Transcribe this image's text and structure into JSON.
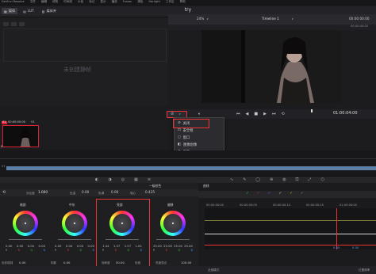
{
  "app": {
    "menu": [
      "DaVinci Resolve",
      "文件",
      "编辑",
      "修剪",
      "时间线",
      "片段",
      "标记",
      "显示",
      "播放",
      "Fusion",
      "调色",
      "Fairlight",
      "工作区",
      "帮助"
    ],
    "project_title": "try"
  },
  "toolbar": {
    "media_pool": "媒体",
    "lut": "LUT",
    "clip_library": "媒体夹",
    "zoom": "24%",
    "timeline_name": "Timeline 1",
    "timecode_top": "00:00:00:00"
  },
  "media_panel": {
    "watermark": "未创建静帧"
  },
  "viewer": {
    "overlay_menu_icon": "circle-slash-icon",
    "timecode": "01:00:04:00"
  },
  "dropdown": {
    "items": [
      {
        "label": "关闭",
        "icon": "off-icon"
      },
      {
        "label": "安全框",
        "icon": "safe-area-icon"
      },
      {
        "label": "窗口",
        "icon": "window-icon"
      },
      {
        "label": "图像划像",
        "icon": "wipe-icon"
      },
      {
        "label": "跟踪",
        "icon": "tracker-icon"
      },
      {
        "label": "Open FX 叠加",
        "icon": "fx-overlay-icon"
      },
      {
        "label": "蒸汽",
        "icon": "other-icon"
      }
    ]
  },
  "clip": {
    "index": "01",
    "timecode": "00:00:00:00",
    "track": "V1",
    "format": "JPEG"
  },
  "color": {
    "params": {
      "contrast_label": "对比度",
      "contrast": "1.000",
      "pivot_label": "轴心",
      "pivot": "0.435",
      "temp_label": "色温",
      "temp": "0.00",
      "tint_label": "色调",
      "tint": "0.00",
      "mode_label": "一级校色"
    },
    "wheels": [
      {
        "label": "暗部",
        "values": [
          "0.00",
          "0.00",
          "0.00",
          "0.00"
        ],
        "channels": [
          "Y",
          "R",
          "G",
          "B"
        ]
      },
      {
        "label": "中灰",
        "values": [
          "0.00",
          "0.00",
          "0.00",
          "0.00"
        ],
        "channels": [
          "Y",
          "R",
          "G",
          "B"
        ]
      },
      {
        "label": "亮部",
        "values": [
          "1.44",
          "1.57",
          "1.57",
          "1.61"
        ],
        "channels": [
          "Y",
          "R",
          "G",
          "B"
        ]
      },
      {
        "label": "偏移",
        "values": [
          "25.00",
          "25.00",
          "25.00",
          "25.00"
        ],
        "channels": [
          "Y",
          "R",
          "G",
          "B"
        ]
      }
    ],
    "footer": {
      "col_boost_label": "色彩增强",
      "col_boost": "0.00",
      "shadow_label": "阴影",
      "shadow": "0.00",
      "midtone_label": "中间调细节",
      "midtone": "50.00",
      "sat_label": "饱和度",
      "sat": "50.00",
      "hue_label": "色相",
      "hue": "50.00",
      "lum_label": "亮度混合",
      "lum": "100.00"
    }
  },
  "curves": {
    "title": "曲线",
    "ruler": [
      "00:00:00:00",
      "00:00:00:05",
      "00:00:00:10",
      "00:00:00:15",
      "01:00:00:00"
    ],
    "right_value": "0.00",
    "bottom_left": "全部模式",
    "bottom_right": "位置频率"
  },
  "colors": {
    "accent_red": "#e33333",
    "timeline_clip": "#5d7fa6"
  }
}
